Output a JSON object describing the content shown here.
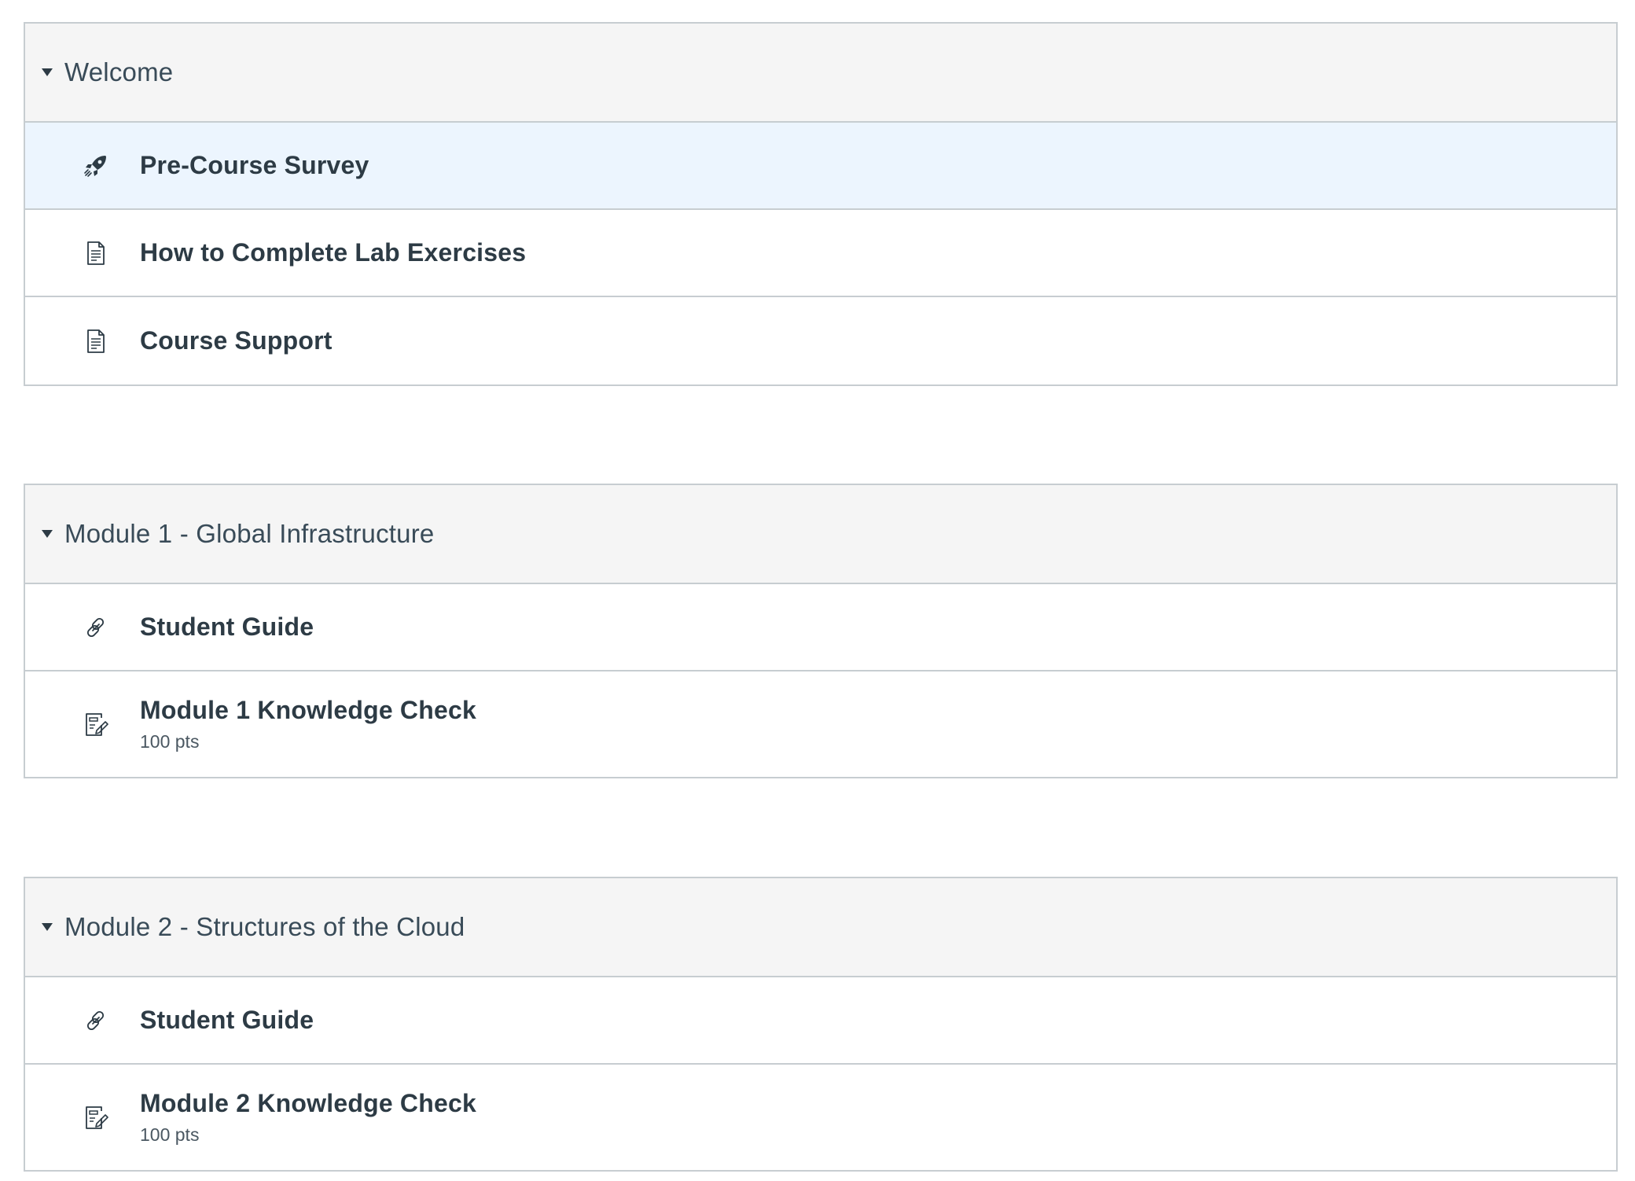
{
  "modules": [
    {
      "title": "Welcome",
      "items": [
        {
          "icon": "quiz-rocket-icon",
          "title": "Pre-Course Survey",
          "meta": ""
        },
        {
          "icon": "page-document-icon",
          "title": "How to Complete Lab Exercises",
          "meta": ""
        },
        {
          "icon": "page-document-icon",
          "title": "Course Support",
          "meta": ""
        }
      ]
    },
    {
      "title": "Module 1 - Global Infrastructure",
      "items": [
        {
          "icon": "external-link-icon",
          "title": "Student Guide",
          "meta": ""
        },
        {
          "icon": "assignment-icon",
          "title": "Module 1 Knowledge Check",
          "meta": "100 pts"
        }
      ]
    },
    {
      "title": "Module 2 - Structures of the Cloud",
      "items": [
        {
          "icon": "external-link-icon",
          "title": "Student Guide",
          "meta": ""
        },
        {
          "icon": "assignment-icon",
          "title": "Module 2 Knowledge Check",
          "meta": "100 pts"
        }
      ]
    }
  ],
  "colors": {
    "header_bg": "#f5f5f5",
    "highlight_bg": "#ecf5fe",
    "border": "#c7cdd1",
    "text": "#2d3b45"
  }
}
